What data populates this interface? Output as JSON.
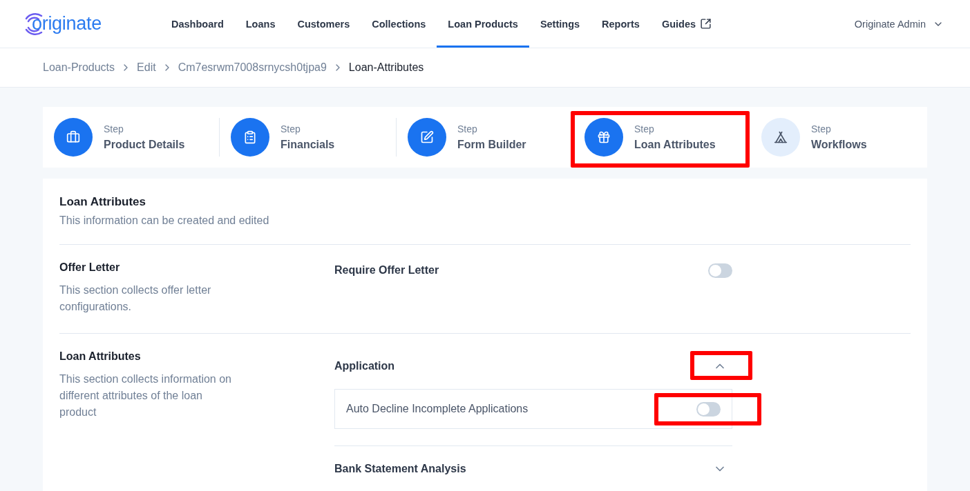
{
  "header": {
    "logo": "originate",
    "nav": [
      {
        "label": "Dashboard",
        "selected": false
      },
      {
        "label": "Loans",
        "selected": false
      },
      {
        "label": "Customers",
        "selected": false
      },
      {
        "label": "Collections",
        "selected": false
      },
      {
        "label": "Loan Products",
        "selected": true
      },
      {
        "label": "Settings",
        "selected": false
      },
      {
        "label": "Reports",
        "selected": false
      },
      {
        "label": "Guides",
        "selected": false,
        "external": true
      }
    ],
    "user": "Originate Admin"
  },
  "breadcrumb": [
    "Loan-Products",
    "Edit",
    "Cm7esrwm7008srnycsh0tjpa9",
    "Loan-Attributes"
  ],
  "steps": [
    {
      "caption": "Step",
      "label": "Product Details",
      "reached": true,
      "highlighted": false
    },
    {
      "caption": "Step",
      "label": "Financials",
      "reached": true,
      "highlighted": false
    },
    {
      "caption": "Step",
      "label": "Form Builder",
      "reached": true,
      "highlighted": false
    },
    {
      "caption": "Step",
      "label": "Loan Attributes",
      "reached": true,
      "highlighted": true
    },
    {
      "caption": "Step",
      "label": "Workflows",
      "reached": false,
      "highlighted": false
    }
  ],
  "card": {
    "title": "Loan Attributes",
    "subtitle": "This information can be created and edited"
  },
  "sections": [
    {
      "kind": "toggles",
      "title": "Offer Letter",
      "description": "This section collects offer letter configurations.",
      "settings": [
        {
          "label": "Require Offer Letter",
          "on": false,
          "highlighted": false
        }
      ]
    },
    {
      "kind": "accordion",
      "title": "Loan Attributes",
      "description": "This section collects information on different attributes of the loan product",
      "groups": [
        {
          "title": "Application",
          "expanded": true,
          "highlighted": true,
          "settings": [
            {
              "label": "Auto Decline Incomplete Applications",
              "on": false,
              "highlighted": true
            }
          ]
        },
        {
          "title": "Bank Statement Analysis",
          "expanded": false,
          "highlighted": false
        }
      ]
    }
  ]
}
